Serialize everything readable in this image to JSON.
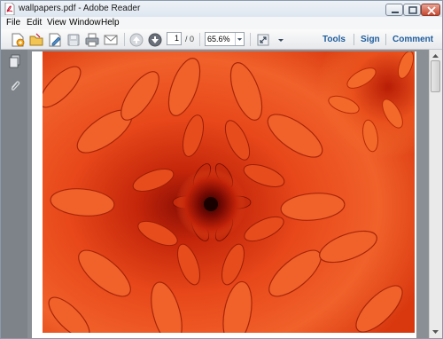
{
  "window": {
    "title": "wallpapers.pdf - Adobe Reader",
    "app_icon": "pdf-icon"
  },
  "menu": {
    "items": [
      "File",
      "Edit",
      "View",
      "Window",
      "Help"
    ]
  },
  "toolbar": {
    "icons": [
      "create-pdf-icon",
      "open-icon",
      "edit-icon",
      "save-icon",
      "print-icon",
      "email-icon",
      "previous-page-icon",
      "next-page-icon",
      "select-tool-icon",
      "zoom-menu-icon"
    ],
    "page_number": "1",
    "page_total": "/ 0",
    "zoom": "65.6%",
    "links": {
      "tools": "Tools",
      "sign": "Sign",
      "comment": "Comment"
    },
    "link_color": "#1f5d9d"
  },
  "left_nav": {
    "icons": [
      "page-thumbnails-icon",
      "attachments-icon"
    ]
  },
  "document": {
    "image_subject": "orange-chrysanthemum",
    "accent_color": "#e0451a"
  }
}
